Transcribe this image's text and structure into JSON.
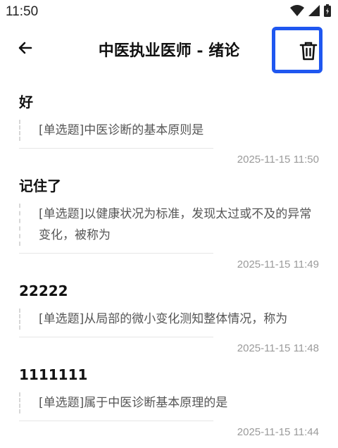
{
  "status": {
    "time": "11:50"
  },
  "header": {
    "title": "中医执业医师 - 绪论"
  },
  "notes": [
    {
      "title": "好",
      "question": "[单选题]中医诊断的基本原则是",
      "time": "2025-11-15 11:50"
    },
    {
      "title": "记住了",
      "question": "[单选题]以健康状况为标准，发现太过或不及的异常变化，被称为",
      "time": "2025-11-15 11:49"
    },
    {
      "title": "22222",
      "question": "[单选题]从局部的微小变化测知整体情况，称为",
      "time": "2025-11-15 11:48"
    },
    {
      "title": "1111111",
      "question": "[单选题]属于中医诊断基本原理的是",
      "time": "2025-11-15 11:44"
    }
  ],
  "icons": {
    "back": "arrow-left-icon",
    "delete": "trash-icon",
    "wifi": "wifi-icon",
    "signal": "signal-icon",
    "battery": "battery-icon"
  },
  "colors": {
    "highlight": "#1f57f0"
  }
}
